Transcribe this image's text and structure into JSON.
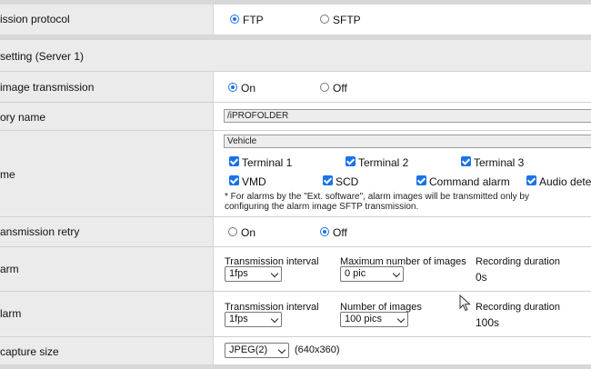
{
  "rows": {
    "transmission_protocol": {
      "label": "ission protocol",
      "options": [
        "FTP",
        "SFTP"
      ],
      "selected": "FTP"
    },
    "section_header": {
      "label": "setting (Server 1)"
    },
    "image_transmission": {
      "label": "image transmission",
      "options": [
        "On",
        "Off"
      ],
      "selected": "On"
    },
    "directory_name": {
      "label": "ory name",
      "value": "/iPROFOLDER"
    },
    "file_name": {
      "label": "me",
      "value": "Vehicle",
      "checkboxes": [
        "Terminal 1",
        "Terminal 2",
        "Terminal 3",
        "VMD",
        "SCD",
        "Command alarm",
        "Audio dete"
      ],
      "note_line1": "* For alarms by the \"Ext. software\", alarm images will be transmitted only by",
      "note_line2": "configuring the alarm image SFTP transmission."
    },
    "transmission_retry": {
      "label": "ansmission retry",
      "options": [
        "On",
        "Off"
      ],
      "selected": "Off"
    },
    "pre_alarm": {
      "label": "arm",
      "interval_label": "Transmission interval",
      "interval_value": "1fps",
      "count_label": "Maximum number of images",
      "count_value": "0 pic",
      "duration_label": "Recording duration",
      "duration_value": "0s"
    },
    "post_alarm": {
      "label": "larm",
      "interval_label": "Transmission interval",
      "interval_value": "1fps",
      "count_label": "Number of images",
      "count_value": "100 pics",
      "duration_label": "Recording duration",
      "duration_value": "100s"
    },
    "capture_size": {
      "label": "capture size",
      "value": "JPEG(2)",
      "resolution": "(640x360)"
    }
  },
  "colors": {
    "accent": "#1a73e8",
    "label_bg": "#ebebeb",
    "band": "#d8d8d8"
  }
}
